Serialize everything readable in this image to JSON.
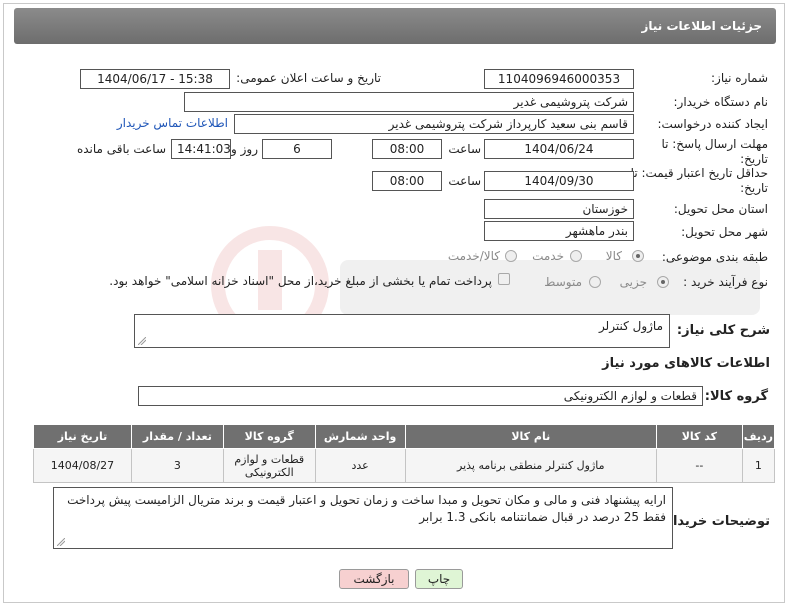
{
  "header": {
    "title": "جزئیات اطلاعات نیاز"
  },
  "fields": {
    "need_number_label": "شماره نیاز:",
    "need_number": "1104096946000353",
    "announce_label": "تاریخ و ساعت اعلان عمومی:",
    "announce_value": "1404/06/17 - 15:38",
    "buyer_label": "نام دستگاه خریدار:",
    "buyer_value": "شرکت پتروشیمی غدیر",
    "requester_label": "ایجاد کننده درخواست:",
    "requester_value": "قاسم بنی سعید کارپرداز شرکت پتروشیمی غدیر",
    "contact_link": "اطلاعات تماس خریدار",
    "deadline_label": "مهلت ارسال پاسخ: تا تاریخ:",
    "deadline_date": "1404/06/24",
    "time_label": "ساعت",
    "deadline_time": "08:00",
    "days_value": "6",
    "days_label": "روز و",
    "remaining_time": "14:41:03",
    "remaining_label": "ساعت باقی مانده",
    "validity_label": "حداقل تاریخ اعتبار قیمت: تا تاریخ:",
    "validity_date": "1404/09/30",
    "validity_time_label": "ساعت",
    "validity_time": "08:00",
    "province_label": "استان محل تحویل:",
    "province_value": "خوزستان",
    "city_label": "شهر محل تحویل:",
    "city_value": "بندر ماهشهر",
    "category_label": "طبقه بندی موضوعی:",
    "category_options": [
      "کالا",
      "خدمت",
      "کالا/خدمت"
    ],
    "process_label": "نوع فرآیند خرید :",
    "process_options": [
      "جزیی",
      "متوسط"
    ],
    "payment_note": "پرداخت تمام یا بخشی از مبلغ خرید،از محل \"اسناد خزانه اسلامی\" خواهد بود."
  },
  "description": {
    "label": "شرح کلی نیاز:",
    "value": "ماژول کنترلر"
  },
  "goods": {
    "section_title": "اطلاعات کالاهای مورد نیاز",
    "group_label": "گروه کالا:",
    "group_value": "قطعات و لوازم الکترونیکی",
    "columns": [
      "ردیف",
      "کد کالا",
      "نام کالا",
      "واحد شمارش",
      "گروه کالا",
      "تعداد / مقدار",
      "تاریخ نیاز"
    ],
    "rows": [
      [
        "1",
        "--",
        "ماژول کنترلر منطقی برنامه پذیر",
        "عدد",
        "قطعات و لوازم الکترونیکی",
        "3",
        "1404/08/27"
      ]
    ]
  },
  "buyer_notes": {
    "label": "توضیحات خریدار:",
    "value": "ارایه پیشنهاد فنی و مالی و مکان تحویل و مبدا ساخت و زمان تحویل و اعتبار قیمت و برند متریال الزامیست پیش پرداخت فقط 25 درصد در قبال ضمانتنامه بانکی 1.3 برابر"
  },
  "buttons": {
    "print": "چاپ",
    "back": "بازگشت"
  },
  "colors": {
    "header": "#7a7a7a",
    "table_header": "#707070",
    "back_button": "#f7d0d0",
    "print_button": "#dff5d5",
    "link": "#1f56b8"
  }
}
